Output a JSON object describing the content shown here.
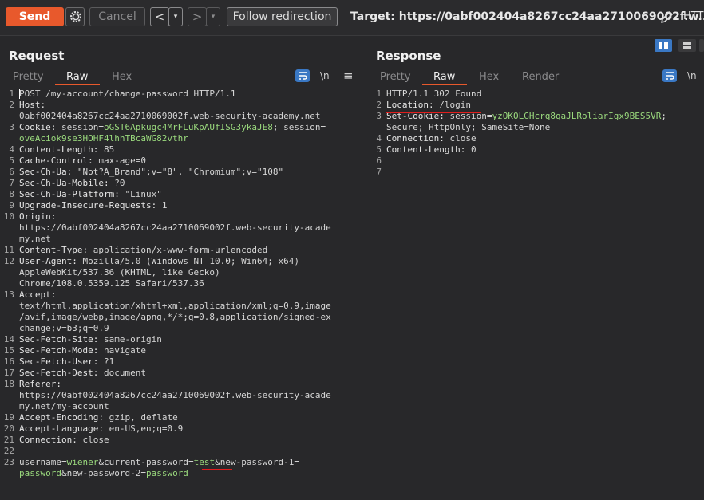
{
  "toolbar": {
    "send_label": "Send",
    "cancel_label": "Cancel",
    "back_label": "<",
    "dropdown_glyph": "▾",
    "forward_label": ">",
    "follow_label": "Follow redirection",
    "target_text": "Target: https://0abf002404a8267cc24aa2710069002f.w...",
    "http_version": "HTTP/1"
  },
  "request": {
    "title": "Request",
    "tabs": [
      "Pretty",
      "Raw",
      "Hex"
    ],
    "active_tab": "Raw",
    "newline_label": "\\n",
    "menu_glyph": "≡",
    "lines": [
      {
        "n": "1",
        "parts": [
          {
            "t": "POST /my-account/change-password HTTP/1.1",
            "c": "val"
          }
        ]
      },
      {
        "n": "2",
        "parts": [
          {
            "t": "Host:",
            "c": "hdr"
          }
        ]
      },
      {
        "n": "",
        "parts": [
          {
            "t": "0abf002404a8267cc24aa2710069002f.web-security-academy.net",
            "c": "val"
          }
        ]
      },
      {
        "n": "3",
        "parts": [
          {
            "t": "Cookie: ",
            "c": "hdr"
          },
          {
            "t": "session",
            "c": "val"
          },
          {
            "t": "=",
            "c": "eq"
          },
          {
            "t": "oGST6Apkugc4MrFLuKpAUfISG3ykaJE8",
            "c": "green"
          },
          {
            "t": "; ",
            "c": "val"
          },
          {
            "t": "session",
            "c": "val"
          },
          {
            "t": "=",
            "c": "eq"
          }
        ]
      },
      {
        "n": "",
        "parts": [
          {
            "t": "oveAciok9se3HOHF4lhhTBcaWG82vthr",
            "c": "green"
          }
        ]
      },
      {
        "n": "4",
        "parts": [
          {
            "t": "Content-Length: ",
            "c": "hdr"
          },
          {
            "t": "85",
            "c": "val"
          }
        ]
      },
      {
        "n": "5",
        "parts": [
          {
            "t": "Cache-Control: ",
            "c": "hdr"
          },
          {
            "t": "max-age=0",
            "c": "val"
          }
        ]
      },
      {
        "n": "6",
        "parts": [
          {
            "t": "Sec-Ch-Ua: ",
            "c": "hdr"
          },
          {
            "t": "\"Not?A_Brand\";v=\"8\", \"Chromium\";v=\"108\"",
            "c": "val"
          }
        ]
      },
      {
        "n": "7",
        "parts": [
          {
            "t": "Sec-Ch-Ua-Mobile: ",
            "c": "hdr"
          },
          {
            "t": "?0",
            "c": "val"
          }
        ]
      },
      {
        "n": "8",
        "parts": [
          {
            "t": "Sec-Ch-Ua-Platform: ",
            "c": "hdr"
          },
          {
            "t": "\"Linux\"",
            "c": "val"
          }
        ]
      },
      {
        "n": "9",
        "parts": [
          {
            "t": "Upgrade-Insecure-Requests: ",
            "c": "hdr"
          },
          {
            "t": "1",
            "c": "val"
          }
        ]
      },
      {
        "n": "10",
        "parts": [
          {
            "t": "Origin:",
            "c": "hdr"
          }
        ]
      },
      {
        "n": "",
        "parts": [
          {
            "t": "https://0abf002404a8267cc24aa2710069002f.web-security-acade",
            "c": "val"
          }
        ]
      },
      {
        "n": "",
        "parts": [
          {
            "t": "my.net",
            "c": "val"
          }
        ]
      },
      {
        "n": "11",
        "parts": [
          {
            "t": "Content-Type: ",
            "c": "hdr"
          },
          {
            "t": "application/x-www-form-urlencoded",
            "c": "val"
          }
        ]
      },
      {
        "n": "12",
        "parts": [
          {
            "t": "User-Agent: ",
            "c": "hdr"
          },
          {
            "t": "Mozilla/5.0 (Windows NT 10.0; Win64; x64)",
            "c": "val"
          }
        ]
      },
      {
        "n": "",
        "parts": [
          {
            "t": "AppleWebKit/537.36 (KHTML, like Gecko)",
            "c": "val"
          }
        ]
      },
      {
        "n": "",
        "parts": [
          {
            "t": "Chrome/108.0.5359.125 Safari/537.36",
            "c": "val"
          }
        ]
      },
      {
        "n": "13",
        "parts": [
          {
            "t": "Accept:",
            "c": "hdr"
          }
        ]
      },
      {
        "n": "",
        "parts": [
          {
            "t": "text/html,application/xhtml+xml,application/xml;q=0.9,image",
            "c": "val"
          }
        ]
      },
      {
        "n": "",
        "parts": [
          {
            "t": "/avif,image/webp,image/apng,*/*;q=0.8,application/signed-ex",
            "c": "val"
          }
        ]
      },
      {
        "n": "",
        "parts": [
          {
            "t": "change;v=b3;q=0.9",
            "c": "val"
          }
        ]
      },
      {
        "n": "14",
        "parts": [
          {
            "t": "Sec-Fetch-Site: ",
            "c": "hdr"
          },
          {
            "t": "same-origin",
            "c": "val"
          }
        ]
      },
      {
        "n": "15",
        "parts": [
          {
            "t": "Sec-Fetch-Mode: ",
            "c": "hdr"
          },
          {
            "t": "navigate",
            "c": "val"
          }
        ]
      },
      {
        "n": "16",
        "parts": [
          {
            "t": "Sec-Fetch-User: ",
            "c": "hdr"
          },
          {
            "t": "?1",
            "c": "val"
          }
        ]
      },
      {
        "n": "17",
        "parts": [
          {
            "t": "Sec-Fetch-Dest: ",
            "c": "hdr"
          },
          {
            "t": "document",
            "c": "val"
          }
        ]
      },
      {
        "n": "18",
        "parts": [
          {
            "t": "Referer:",
            "c": "hdr"
          }
        ]
      },
      {
        "n": "",
        "parts": [
          {
            "t": "https://0abf002404a8267cc24aa2710069002f.web-security-acade",
            "c": "val"
          }
        ]
      },
      {
        "n": "",
        "parts": [
          {
            "t": "my.net/my-account",
            "c": "val"
          }
        ]
      },
      {
        "n": "19",
        "parts": [
          {
            "t": "Accept-Encoding: ",
            "c": "hdr"
          },
          {
            "t": "gzip, deflate",
            "c": "val"
          }
        ]
      },
      {
        "n": "20",
        "parts": [
          {
            "t": "Accept-Language: ",
            "c": "hdr"
          },
          {
            "t": "en-US,en;q=0.9",
            "c": "val"
          }
        ]
      },
      {
        "n": "21",
        "parts": [
          {
            "t": "Connection: ",
            "c": "hdr"
          },
          {
            "t": "close",
            "c": "val"
          }
        ]
      },
      {
        "n": "22",
        "parts": []
      },
      {
        "n": "23",
        "parts": [
          {
            "t": "username",
            "c": "val"
          },
          {
            "t": "=",
            "c": "eq"
          },
          {
            "t": "wiener",
            "c": "green"
          },
          {
            "t": "&current-password",
            "c": "val"
          },
          {
            "t": "=",
            "c": "eq"
          },
          {
            "t": "test",
            "c": "green"
          },
          {
            "t": "&new-password-1",
            "c": "val"
          },
          {
            "t": "=",
            "c": "eq"
          }
        ]
      },
      {
        "n": "",
        "parts": [
          {
            "t": "password",
            "c": "green"
          },
          {
            "t": "&new-password-2",
            "c": "val"
          },
          {
            "t": "=",
            "c": "eq"
          },
          {
            "t": "password",
            "c": "green"
          }
        ]
      }
    ]
  },
  "response": {
    "title": "Response",
    "tabs": [
      "Pretty",
      "Raw",
      "Hex",
      "Render"
    ],
    "active_tab": "Raw",
    "newline_label": "\\n",
    "lines": [
      {
        "n": "1",
        "parts": [
          {
            "t": "HTTP/1.1 302 Found",
            "c": "val"
          }
        ]
      },
      {
        "n": "2",
        "parts": [
          {
            "t": "Location: ",
            "c": "hdr"
          },
          {
            "t": "/login",
            "c": "val"
          }
        ]
      },
      {
        "n": "3",
        "parts": [
          {
            "t": "Set-Cookie: ",
            "c": "hdr"
          },
          {
            "t": "session",
            "c": "val"
          },
          {
            "t": "=",
            "c": "eq"
          },
          {
            "t": "yzOKOLGHcrq8qaJLRoliarIgx9BES5VR",
            "c": "green"
          },
          {
            "t": ";",
            "c": "val"
          }
        ]
      },
      {
        "n": "",
        "parts": [
          {
            "t": "Secure; HttpOnly; SameSite=None",
            "c": "val"
          }
        ]
      },
      {
        "n": "4",
        "parts": [
          {
            "t": "Connection: ",
            "c": "hdr"
          },
          {
            "t": "close",
            "c": "val"
          }
        ]
      },
      {
        "n": "5",
        "parts": [
          {
            "t": "Content-Length: ",
            "c": "hdr"
          },
          {
            "t": "0",
            "c": "val"
          }
        ]
      },
      {
        "n": "6",
        "parts": []
      },
      {
        "n": "7",
        "parts": []
      }
    ]
  },
  "colors": {
    "accent": "#e8592c",
    "highlight_green": "#9ad97d",
    "annotation_red": "#e01d1d",
    "icon_blue": "#3a78c4"
  }
}
